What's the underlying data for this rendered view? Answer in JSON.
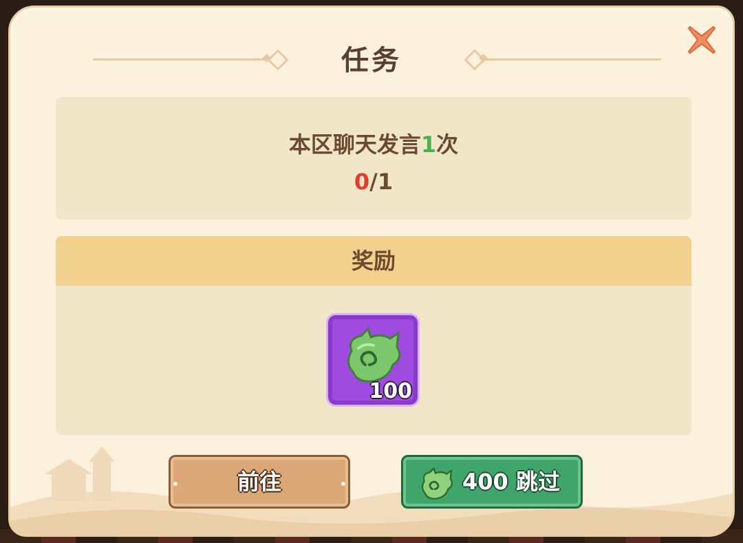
{
  "dialog": {
    "title": "任务"
  },
  "task": {
    "description_prefix": "本区聊天发言",
    "description_count": "1",
    "description_suffix": "次",
    "progress_current": "0",
    "progress_separator": "/1"
  },
  "reward": {
    "header": "奖励",
    "items": [
      {
        "icon": "green-jade-icon",
        "count": "100"
      }
    ]
  },
  "buttons": {
    "go_label": "前往",
    "skip_cost": "400",
    "skip_text": "跳过"
  },
  "colors": {
    "panel_bg": "#fbf1dc",
    "title_text": "#5a3f2c",
    "highlight_green": "#4bb24f",
    "progress_red": "#e53a2c",
    "item_purple": "#a04be0",
    "go_button": "#dba777",
    "skip_button": "#3fa56b"
  }
}
